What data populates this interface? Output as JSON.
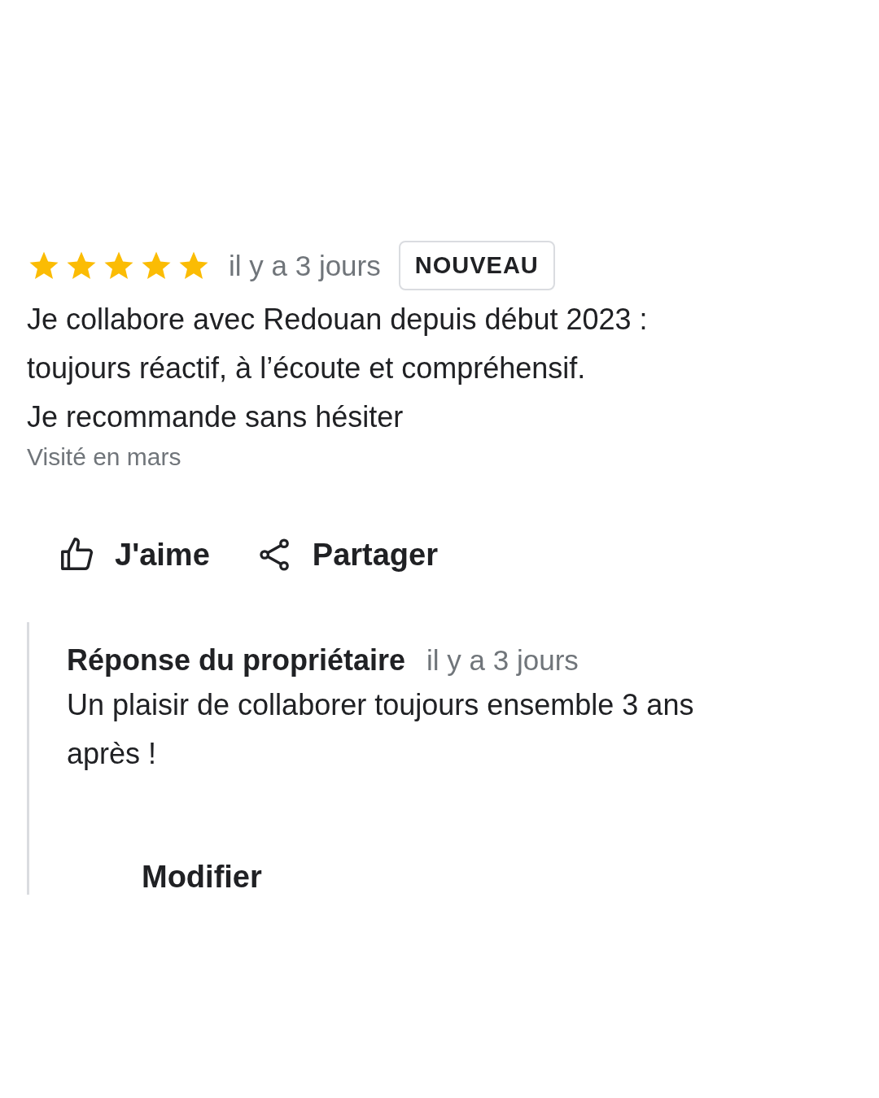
{
  "review": {
    "stars": 5,
    "time": "il y a 3 jours",
    "badge": "NOUVEAU",
    "text_lines": [
      "Je collabore avec Redouan depuis début 2023 :",
      "toujours réactif, à l’écoute et compréhensif.",
      "Je recommande sans hésiter"
    ],
    "visit": "Visité en mars"
  },
  "actions": [
    {
      "kind": "like",
      "label": "J'aime"
    },
    {
      "kind": "share",
      "label": "Partager"
    }
  ],
  "owner_reply": {
    "title": "Réponse du propriétaire",
    "time": "il y a 3 jours",
    "text": "Un plaisir de collaborer toujours ensemble 3 ans après !",
    "edit": "Modifier"
  }
}
